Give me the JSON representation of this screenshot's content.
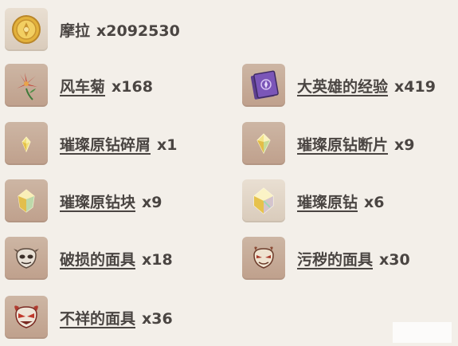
{
  "items": [
    {
      "name": "摩拉",
      "qty": "x2092530",
      "icon": "mora-coin-icon"
    },
    {
      "name": "风车菊",
      "qty": "x168",
      "icon": "windwheel-aster-icon"
    },
    {
      "name": "大英雄的经验",
      "qty": "x419",
      "icon": "heros-wit-book-icon"
    },
    {
      "name": "璀璨原钻碎屑",
      "qty": "x1",
      "icon": "gem-sliver-icon"
    },
    {
      "name": "璀璨原钻断片",
      "qty": "x9",
      "icon": "gem-fragment-icon"
    },
    {
      "name": "璀璨原钻块",
      "qty": "x9",
      "icon": "gem-chunk-icon"
    },
    {
      "name": "璀璨原钻",
      "qty": "x6",
      "icon": "gemstone-icon"
    },
    {
      "name": "破损的面具",
      "qty": "x18",
      "icon": "damaged-mask-icon"
    },
    {
      "name": "污秽的面具",
      "qty": "x30",
      "icon": "stained-mask-icon"
    },
    {
      "name": "不祥的面具",
      "qty": "x36",
      "icon": "ominous-mask-icon"
    }
  ]
}
